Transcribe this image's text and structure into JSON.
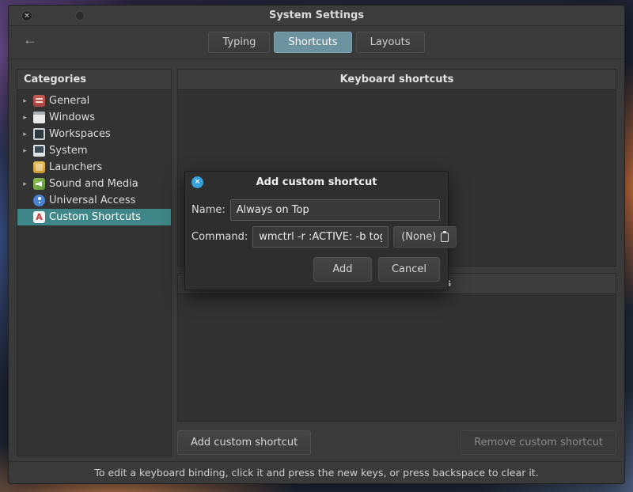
{
  "colors": {
    "tab-active": "#6d93a1",
    "selection": "#3e8687",
    "dialog-close": "#36a0da"
  },
  "icons": {
    "back": "←",
    "close": "×",
    "expander": "▸"
  },
  "window": {
    "title": "System Settings",
    "tabs": [
      {
        "label": "Typing"
      },
      {
        "label": "Shortcuts",
        "active": true
      },
      {
        "label": "Layouts"
      }
    ]
  },
  "sidebar": {
    "header": "Categories",
    "items": [
      {
        "label": "General",
        "icon": "general-icon",
        "expandable": true
      },
      {
        "label": "Windows",
        "icon": "windows-icon",
        "expandable": true
      },
      {
        "label": "Workspaces",
        "icon": "workspaces-icon",
        "expandable": true
      },
      {
        "label": "System",
        "icon": "system-icon",
        "expandable": true
      },
      {
        "label": "Launchers",
        "icon": "launchers-icon",
        "expandable": false
      },
      {
        "label": "Sound and Media",
        "icon": "sound-and-media-icon",
        "expandable": true
      },
      {
        "label": "Universal Access",
        "icon": "universal-access-icon",
        "expandable": false
      },
      {
        "label": "Custom Shortcuts",
        "icon": "custom-shortcuts-icon",
        "expandable": false,
        "selected": true
      }
    ]
  },
  "main": {
    "shortcuts_header": "Keyboard shortcuts",
    "bindings_header": "Keyboard bindings",
    "add_button": "Add custom shortcut",
    "remove_button": "Remove custom shortcut"
  },
  "dialog": {
    "title": "Add custom shortcut",
    "name_label": "Name:",
    "name_value": "Always on Top",
    "command_label": "Command:",
    "command_value": "wmctrl -r :ACTIVE: -b toggl",
    "binding_button": "(None)",
    "add_button": "Add",
    "cancel_button": "Cancel"
  },
  "footer": {
    "hint": "To edit a keyboard binding, click it and press the new keys, or press backspace to clear it."
  }
}
